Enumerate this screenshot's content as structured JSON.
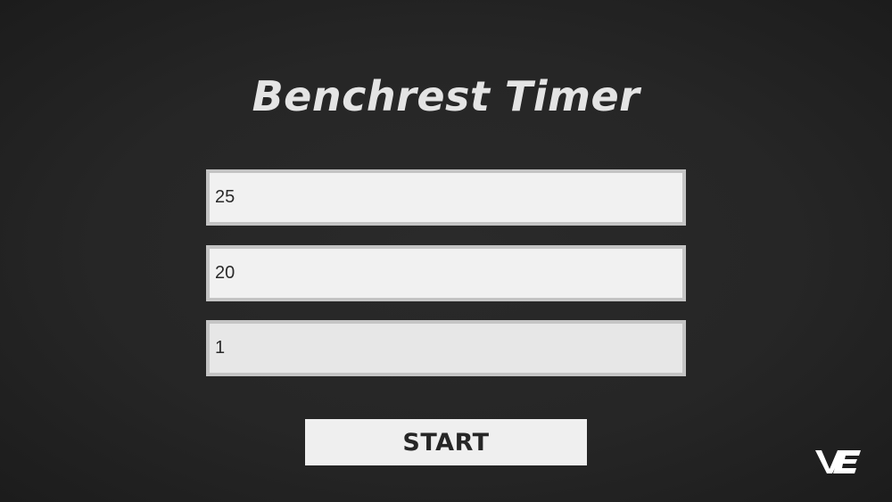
{
  "title": "Benchrest Timer",
  "inputs": [
    {
      "value": "25"
    },
    {
      "value": "20"
    },
    {
      "value": "1"
    }
  ],
  "start_label": "START",
  "logo": {
    "icon": "ve-logo-icon",
    "text": "VE"
  },
  "colors": {
    "background": "#262626",
    "title_text": "#e4e4e4",
    "field_background": "#f1f1f1",
    "field_border": "#c4c4c4",
    "button_background": "#efefef",
    "button_text": "#262626"
  }
}
